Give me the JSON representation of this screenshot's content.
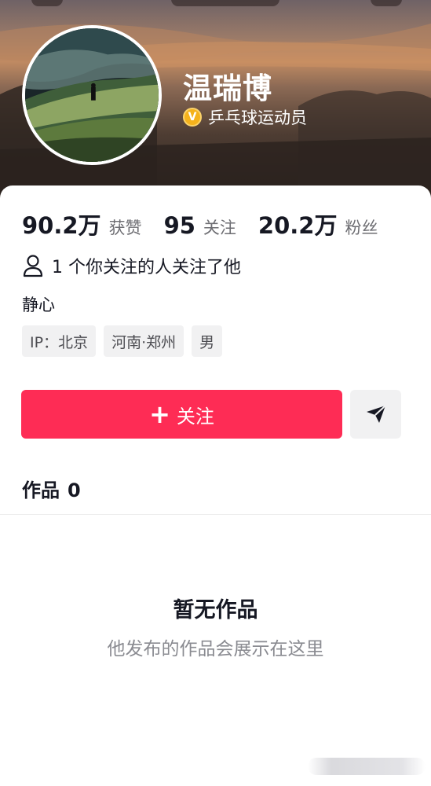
{
  "profile": {
    "name": "温瑞博",
    "verification": "乒乓球运动员",
    "verify_badge": "V"
  },
  "stats": [
    {
      "value": "90.2万",
      "label": "获赞"
    },
    {
      "value": "95",
      "label": "关注"
    },
    {
      "value": "20.2万",
      "label": "粉丝"
    }
  ],
  "mutual": {
    "text": "1 个你关注的人关注了他",
    "icon": "person-icon"
  },
  "bio": "静心",
  "tags": [
    "IP：北京",
    "河南·郑州",
    "男"
  ],
  "actions": {
    "follow_plus": "+",
    "follow_label": "关注",
    "message_icon": "send-icon"
  },
  "works": {
    "label": "作品",
    "count": "0"
  },
  "empty": {
    "title": "暂无作品",
    "subtitle": "他发布的作品会展示在这里"
  },
  "colors": {
    "accent": "#fe2c55",
    "verify": "#f5b21c",
    "secondary_text": "#8a8b91"
  }
}
